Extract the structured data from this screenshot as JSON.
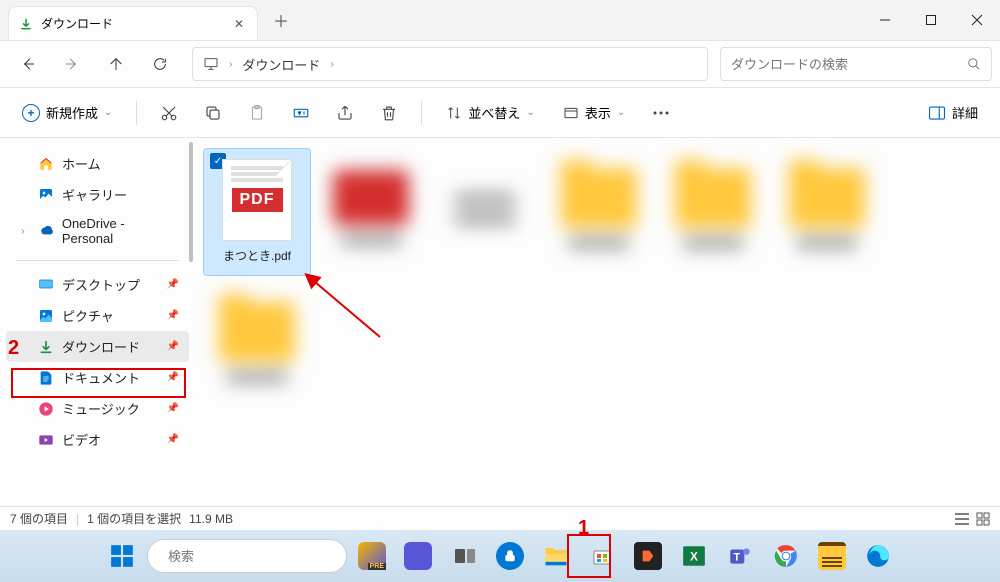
{
  "tab": {
    "title": "ダウンロード"
  },
  "path": {
    "current": "ダウンロード"
  },
  "search": {
    "placeholder": "ダウンロードの検索"
  },
  "toolbar": {
    "new": "新規作成",
    "sort": "並べ替え",
    "view": "表示",
    "details": "詳細"
  },
  "sidebar": {
    "home": "ホーム",
    "gallery": "ギャラリー",
    "onedrive": "OneDrive - Personal",
    "desktop": "デスクトップ",
    "pictures": "ピクチャ",
    "downloads": "ダウンロード",
    "documents": "ドキュメント",
    "music": "ミュージック",
    "videos": "ビデオ"
  },
  "file": {
    "name": "まつとき.pdf",
    "pdf_label": "PDF"
  },
  "status": {
    "items": "7 個の項目",
    "selected": "1 個の項目を選択",
    "size": "11.9 MB"
  },
  "taskbar": {
    "search_placeholder": "検索"
  },
  "annotations": {
    "one": "1",
    "two": "2"
  }
}
